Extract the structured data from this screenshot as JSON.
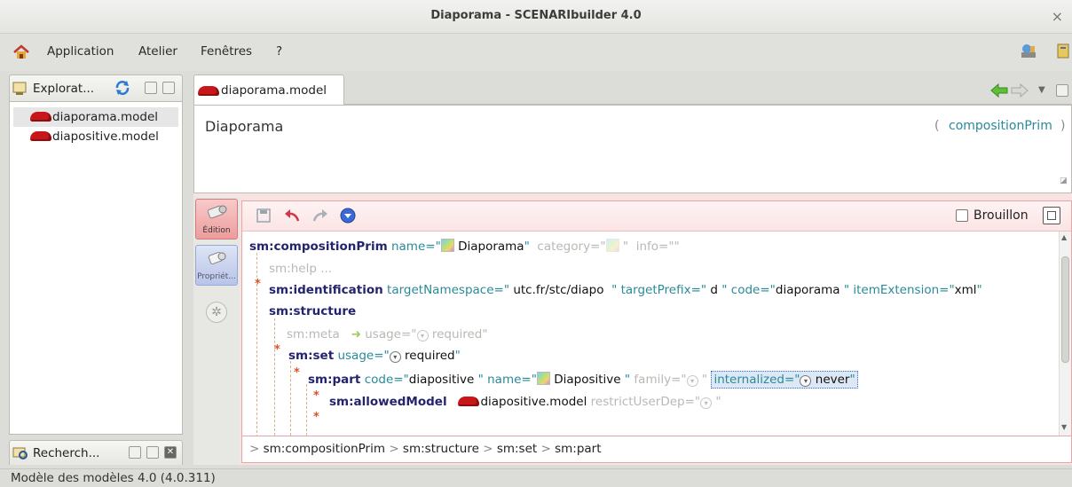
{
  "window": {
    "title": "Diaporama - SCENARIbuilder 4.0",
    "close": "×"
  },
  "menu": {
    "items": [
      "Application",
      "Atelier",
      "Fenêtres",
      "?"
    ]
  },
  "explorer": {
    "tab_label": "Explorat...",
    "items": [
      "diaporama.model",
      "diapositive.model"
    ]
  },
  "search": {
    "tab_label": "Recherch..."
  },
  "editor": {
    "tab_label": "diaporama.model",
    "title": "Diaporama",
    "type_open": "(",
    "type_name": "compositionPrim",
    "type_close": ")",
    "brouillon_label": "Brouillon",
    "side_tabs": [
      "Édition",
      "Propriét..."
    ]
  },
  "code": {
    "l1": {
      "kw": "sm:compositionPrim",
      "a1": "name=\"",
      "v1": "Diaporama",
      "q1": "\"",
      "a2": "category=\"",
      "q2": "\"",
      "a3": "info=\"",
      "q3": "\""
    },
    "l2": {
      "text": "sm:help",
      "more": "..."
    },
    "l3": {
      "kw": "sm:identification",
      "a1": "targetNamespace=\"",
      "v1": "utc.fr/stc/diapo",
      "q1": "\"",
      "a2": "targetPrefix=\"",
      "v2": "d",
      "q2": "\"",
      "a3": "code=\"",
      "v3": "diaporama",
      "q3": "\"",
      "a4": "itemExtension=\"",
      "v4": "xml",
      "q4": "\""
    },
    "l4": {
      "kw": "sm:structure"
    },
    "l5": {
      "kw": "sm:meta",
      "a1": "usage=\"",
      "v1": "required",
      "q1": "\""
    },
    "l6": {
      "kw": "sm:set",
      "a1": "usage=\"",
      "v1": "required",
      "q1": "\""
    },
    "l7": {
      "kw": "sm:part",
      "a1": "code=\"",
      "v1": "diapositive",
      "q1": "\"",
      "a2": "name=\"",
      "v2": "Diapositive",
      "q2": "\"",
      "a3": "family=\"",
      "q3": "\"",
      "a4": "internalized=\"",
      "v4": "never",
      "q4": "\""
    },
    "l8": {
      "kw": "sm:allowedModel",
      "v1": "diapositive.model",
      "a1": "restrictUserDep=\"",
      "q1": "\""
    }
  },
  "breadcrumb": {
    "sep": ">",
    "items": [
      "sm:compositionPrim",
      "sm:structure",
      "sm:set",
      "sm:part"
    ]
  },
  "status": {
    "text": "Modèle des modèles 4.0 (4.0.311)"
  },
  "colors": {
    "accent_red": "#c8171a",
    "keyword": "#24246e",
    "attribute": "#2a8a98",
    "required_star": "#e05028"
  }
}
